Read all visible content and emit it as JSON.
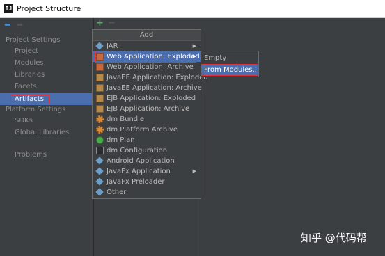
{
  "window": {
    "title": "Project Structure",
    "app_icon": "IJ"
  },
  "nav": {
    "back_icon": "back-arrow-icon",
    "forward_icon": "forward-arrow-icon"
  },
  "sidebar": {
    "project_settings_header": "Project Settings",
    "project_items": [
      "Project",
      "Modules",
      "Libraries",
      "Facets",
      "Artifacts"
    ],
    "platform_settings_header": "Platform Settings",
    "platform_items": [
      "SDKs",
      "Global Libraries"
    ],
    "other_items": [
      "Problems"
    ],
    "selected": "Artifacts"
  },
  "toolbar": {
    "add_symbol": "+",
    "remove_symbol": "−"
  },
  "add_menu": {
    "title": "Add",
    "items": [
      {
        "label": "JAR",
        "icon": "jar-icon",
        "submenu": true
      },
      {
        "label": "Web Application: Exploded",
        "icon": "web-app-icon",
        "submenu": true,
        "selected": true
      },
      {
        "label": "Web Application: Archive",
        "icon": "web-app-icon",
        "submenu": false
      },
      {
        "label": "JavaEE Application: Exploded",
        "icon": "javaee-icon",
        "submenu": false
      },
      {
        "label": "JavaEE Application: Archive",
        "icon": "javaee-icon",
        "submenu": false
      },
      {
        "label": "EJB Application: Exploded",
        "icon": "ejb-icon",
        "submenu": false
      },
      {
        "label": "EJB Application: Archive",
        "icon": "ejb-icon",
        "submenu": false
      },
      {
        "label": "dm Bundle",
        "icon": "dm-bundle-icon",
        "submenu": false
      },
      {
        "label": "dm Platform Archive",
        "icon": "dm-platform-icon",
        "submenu": false
      },
      {
        "label": "dm Plan",
        "icon": "dm-plan-icon",
        "submenu": false
      },
      {
        "label": "dm Configuration",
        "icon": "dm-config-icon",
        "submenu": false
      },
      {
        "label": "Android Application",
        "icon": "android-icon",
        "submenu": false
      },
      {
        "label": "JavaFx Application",
        "icon": "javafx-icon",
        "submenu": true
      },
      {
        "label": "JavaFx Preloader",
        "icon": "javafx-icon",
        "submenu": false
      },
      {
        "label": "Other",
        "icon": "other-icon",
        "submenu": false
      }
    ]
  },
  "sub_menu": {
    "items": [
      {
        "label": "Empty",
        "selected": false
      },
      {
        "label": "From Modules...",
        "selected": true
      }
    ]
  },
  "watermark": "知乎 @代码帮",
  "colors": {
    "selection": "#4b6eaf",
    "highlight_border": "#e0303a",
    "background": "#3c3f41"
  }
}
